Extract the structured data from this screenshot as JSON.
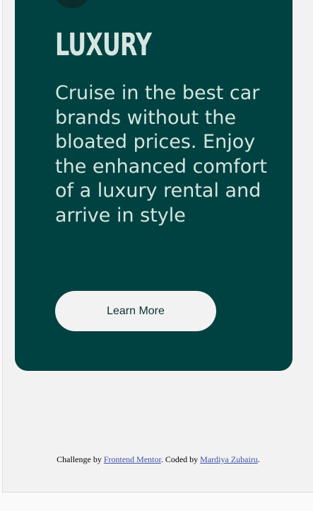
{
  "card": {
    "title": "LUXURY",
    "description": "Cruise in the best car brands without the bloated prices. Enjoy the enhanced comfort of a luxury rental and arrive in style",
    "button_label": "Learn More",
    "icon": "car-icon",
    "background_color": "#004241",
    "text_color": "#d4e4df"
  },
  "footer": {
    "challenge_prefix": "Challenge by ",
    "challenge_link": "Frontend Mentor",
    "coded_prefix": ". Coded by ",
    "author_link": "Mardiya Zubairu",
    "suffix": ".",
    "link_color": "#3e52a3"
  }
}
